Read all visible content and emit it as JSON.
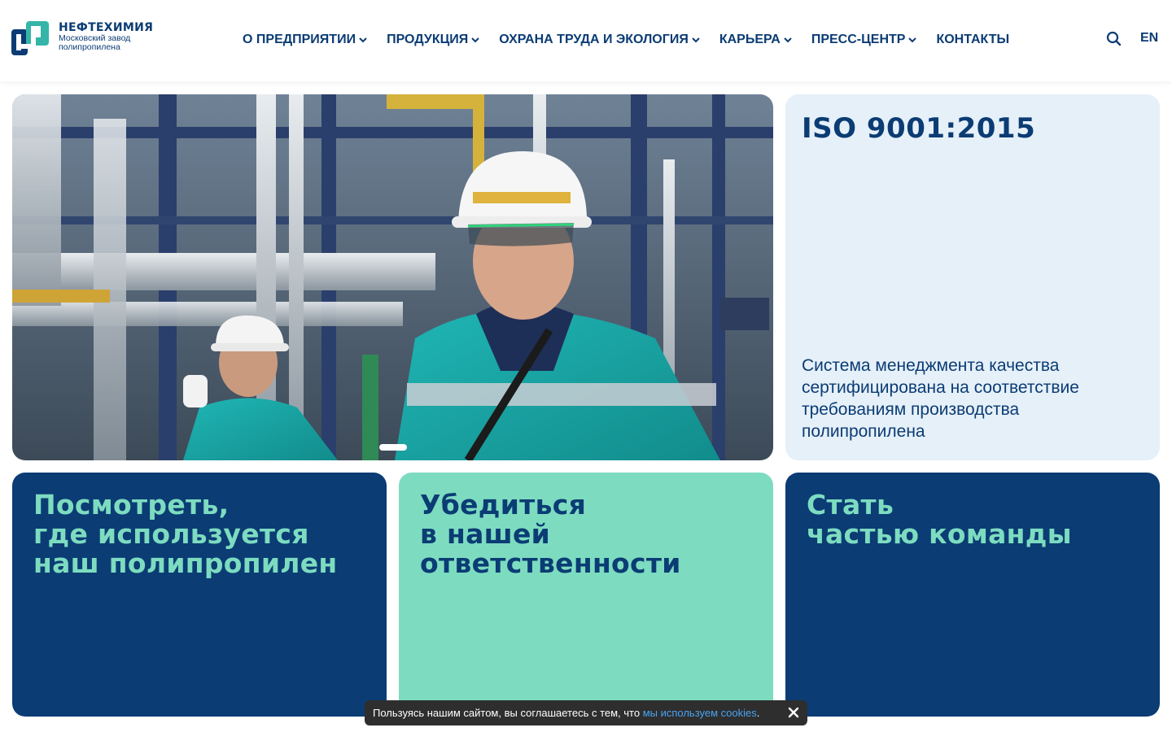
{
  "brand": {
    "title": "НЕФТЕХИМИЯ",
    "subtitle_line1": "Московский завод",
    "subtitle_line2": "полипропилена",
    "logo_icon": "logo-mark-icon",
    "colors": {
      "navy": "#0b3c74",
      "mint": "#7ddcc0",
      "light": "#e6f0f8"
    }
  },
  "nav": {
    "items": [
      {
        "label": "О ПРЕДПРИЯТИИ",
        "has_dropdown": true
      },
      {
        "label": "ПРОДУКЦИЯ",
        "has_dropdown": true
      },
      {
        "label": "ОХРАНА ТРУДА И ЭКОЛОГИЯ",
        "has_dropdown": true
      },
      {
        "label": "КАРЬЕРА",
        "has_dropdown": true
      },
      {
        "label": "ПРЕСС-ЦЕНТР",
        "has_dropdown": true
      },
      {
        "label": "КОНТАКТЫ",
        "has_dropdown": false
      }
    ],
    "search_icon": "search-icon",
    "lang": "EN"
  },
  "hero": {
    "image": "workers-in-hard-hats-at-plant",
    "slides_total": 1,
    "active_slide": 1
  },
  "iso_card": {
    "title": "ISO 9001:2015",
    "text": "Система менеджмента качества сертифицирована на соответствие требованиям производства полипропилена"
  },
  "tiles": [
    {
      "title": "Посмотреть,\nгде используется\nнаш полипропилен"
    },
    {
      "title": "Убедиться\nв нашей\nответственности"
    },
    {
      "title": "Стать\nчастью команды"
    }
  ],
  "cookie": {
    "text": "Пользуясь нашим сайтом, вы соглашаетесь с тем, что ",
    "link": "мы используем cookies",
    "end": ".",
    "close_icon": "close-icon"
  }
}
